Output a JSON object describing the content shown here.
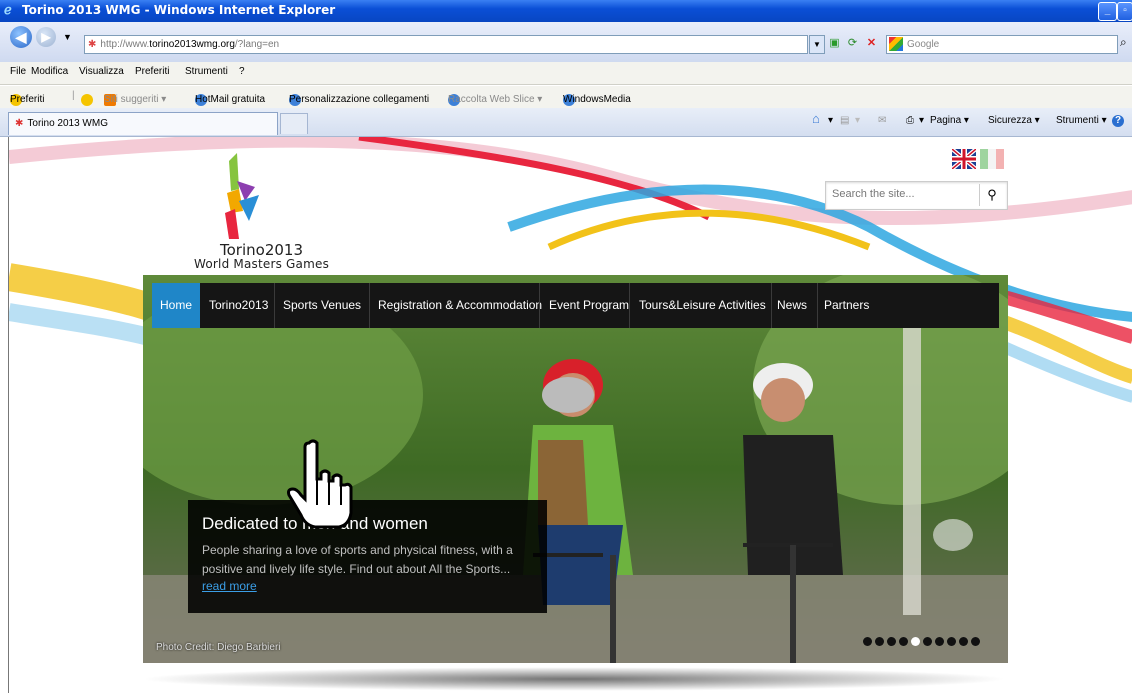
{
  "window": {
    "title": "Torino 2013 WMG - Windows Internet Explorer"
  },
  "address_bar": {
    "url_prefix": "http://www.",
    "url_host": "torino2013wmg.org",
    "url_suffix": "/?lang=en",
    "search_placeholder": "Google"
  },
  "menu": {
    "items": [
      "File",
      "Modifica",
      "Visualizza",
      "Preferiti",
      "Strumenti",
      "?"
    ]
  },
  "favorites_bar": {
    "favorites_label": "Preferiti",
    "items": [
      "Siti suggeriti ▾",
      "HotMail gratuita",
      "Personalizzazione collegamenti",
      "Raccolta Web Slice ▾",
      "WindowsMedia"
    ]
  },
  "tabs": {
    "active_tab": "Torino 2013 WMG"
  },
  "command_bar": {
    "items": [
      "Pagina ▾",
      "Sicurezza ▾",
      "Strumenti ▾"
    ]
  },
  "site": {
    "logo_line1": "Torino2013",
    "logo_line2": "World Masters Games",
    "search_placeholder": "Search the site...",
    "nav": [
      "Home",
      "Torino2013",
      "Sports Venues",
      "Registration & Accommodation",
      "Event Program",
      "Tours&Leisure Activities",
      "News",
      "Partners"
    ],
    "caption": {
      "heading": "Dedicated to men and women",
      "text": "People sharing a love of sports and physical fitness, with a positive and lively life style. Find out about All the Sports...",
      "link": "read more"
    },
    "photo_credit": "Photo Credit: Diego Barbieri",
    "slides_count": 10,
    "colors": {
      "nav_active": "#1f86c8",
      "nav_bg": "#151515",
      "link": "#3b9ee6"
    }
  }
}
